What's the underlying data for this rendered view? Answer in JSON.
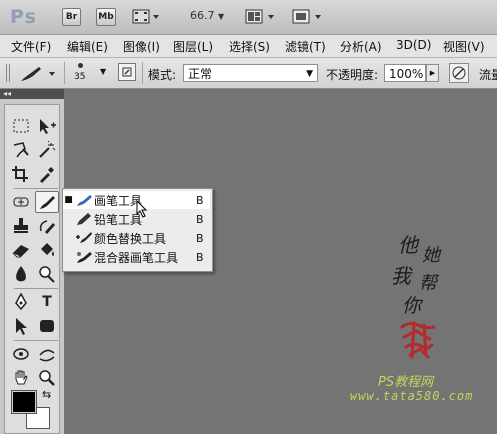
{
  "app": {
    "logo": "Ps",
    "bridge_btn": "Br",
    "minibridge_btn": "Mb",
    "zoom_level": "66.7"
  },
  "menu": {
    "items": [
      "文件(F)",
      "编辑(E)",
      "图像(I)",
      "图层(L)",
      "选择(S)",
      "滤镜(T)",
      "分析(A)",
      "3D(D)",
      "视图(V)"
    ]
  },
  "options_bar": {
    "brush_size": "35",
    "mode_label": "模式:",
    "mode_value": "正常",
    "opacity_label": "不透明度:",
    "opacity_value": "100%",
    "flow_label": "流量"
  },
  "flyout": {
    "items": [
      {
        "label": "画笔工具",
        "key": "B",
        "selected": true
      },
      {
        "label": "铅笔工具",
        "key": "B",
        "selected": false
      },
      {
        "label": "颜色替换工具",
        "key": "B",
        "selected": false
      },
      {
        "label": "混合器画笔工具",
        "key": "B",
        "selected": false
      }
    ]
  },
  "watermark": {
    "chars": [
      "他",
      "她",
      "我",
      "帮",
      "你"
    ],
    "brand": "PS教程网",
    "url": "www.tata580.com"
  },
  "colors": {
    "foreground": "#000000",
    "background": "#ffffff",
    "seal": "#b52a2a",
    "watermark_text": "#c7d35a"
  }
}
